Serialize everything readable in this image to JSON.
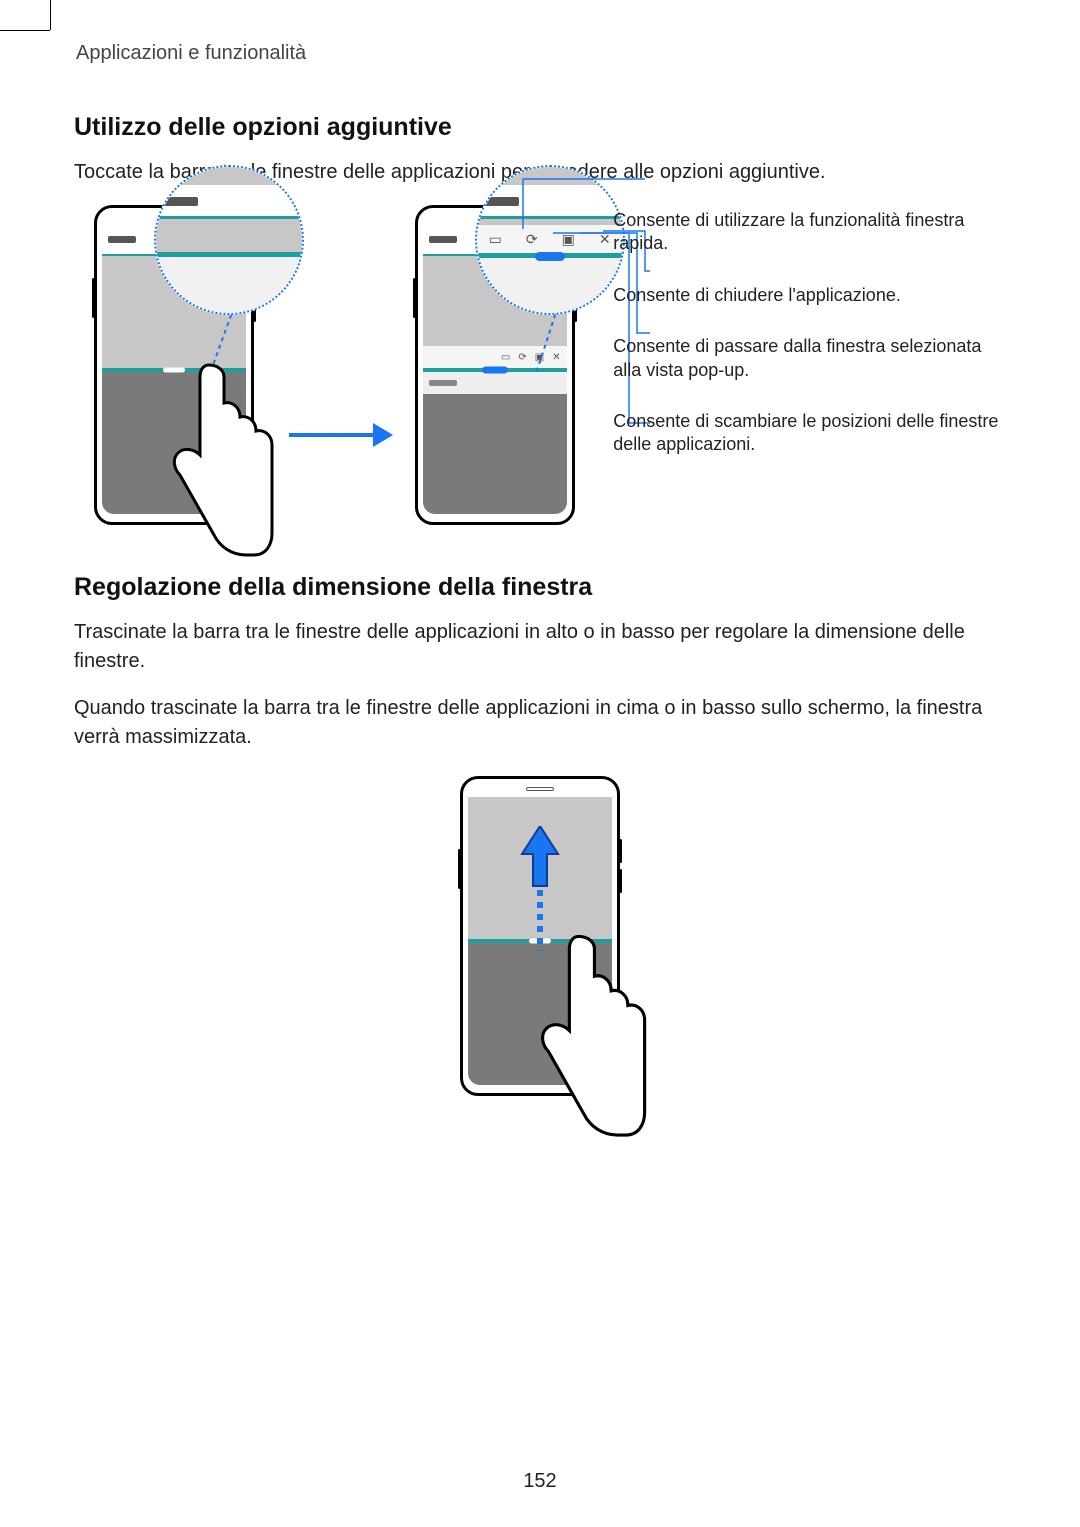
{
  "breadcrumb": "Applicazioni e funzionalità",
  "section1": {
    "heading": "Utilizzo delle opzioni aggiuntive",
    "p1": "Toccate la barra tra le finestre delle applicazioni per accedere alle opzioni aggiuntive."
  },
  "callouts": {
    "c1": "Consente di utilizzare la funzionalità finestra rapida.",
    "c2": "Consente di chiudere l'applicazione.",
    "c3": "Consente di passare dalla finestra selezionata alla vista pop-up.",
    "c4": "Consente di scambiare le posizioni delle finestre delle applicazioni."
  },
  "section2": {
    "heading": "Regolazione della dimensione della finestra",
    "p1": "Trascinate la barra tra le finestre delle applicazioni in alto o in basso per regolare la dimensione delle finestre.",
    "p2": "Quando trascinate la barra tra le finestre delle applicazioni in cima o in basso sullo schermo, la finestra verrà massimizzata."
  },
  "page_number": "152"
}
